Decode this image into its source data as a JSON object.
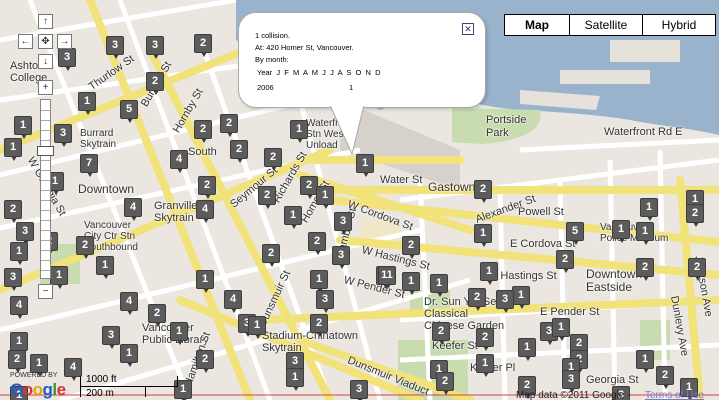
{
  "map_type": {
    "map": "Map",
    "satellite": "Satellite",
    "hybrid": "Hybrid"
  },
  "controls": {
    "up": "↑",
    "left": "←",
    "center": "✥",
    "right": "→",
    "down": "↓",
    "zoom_in": "+",
    "zoom_out": "−"
  },
  "info": {
    "line1": "1 collision.",
    "line2": "At: 420 Homer St, Vancouver.",
    "line3": "By month:",
    "header": "Year  J  F  M  A  M  J  J  A  S  O  N  D",
    "row_year": "2006",
    "row_value": "1",
    "close": "✕"
  },
  "scale": {
    "ft": "1000 ft",
    "m": "200 m"
  },
  "attribution": {
    "powered": "POWERED BY",
    "logo": "Google",
    "copyright": "Map data ©2011 Google -",
    "terms": "Terms of Use"
  },
  "labels": {
    "burrard": "Burrard St",
    "hornby": "Hornby St",
    "w_georgia": "W Georgia St",
    "seymour": "Seymour St",
    "richards": "Richards St",
    "homer": "Homer St",
    "cambie": "Cambie St",
    "water": "Water St",
    "gastown": "Gastown",
    "w_cordova": "W Cordova St",
    "powell": "Powell St",
    "e_cordova": "E Cordova St",
    "w_hastings": "W Hastings St",
    "e_hastings": "E Hastings St",
    "w_pender": "W Pender St",
    "e_pender": "E Pender St",
    "dunsmuir": "Dunsmuir St",
    "dunsmuir_viaduct": "Dunsmuir Viaduct",
    "keefer": "Keefer St",
    "keefer_pl": "Keefer Pl",
    "georgia": "Georgia St",
    "waterfront_rd": "Waterfront Rd E",
    "alexander": "Alexander St",
    "downtown": "Downtown",
    "downtown_eastside": "Downtown\nEastside",
    "portside": "Portside\nPark",
    "granville": "Granville\nSkytrain",
    "waterfront_stn": "Waterfront\nStn West\nUnload",
    "burrard_sky": "Burrard\nSkytrain",
    "vcc": "Vancouver\nCity Ctr Stn\nSouthbound",
    "stadium": "Stadium-Chinatown\nSkytrain",
    "public_lib": "Vancouver\nPublic Library",
    "dr_sun": "Dr. Sun Yat-Sen\nClassical\nChinese Garden",
    "museum": "Vancouver\nPolice Museum",
    "hamilton": "Hamilton St",
    "dunlevy": "Dunlevy Ave",
    "jackson": "Jackson Ave",
    "thurlow": "Thurlow St",
    "ashton": "Ashto\nCollege",
    "south": "South"
  },
  "markers": [
    "3",
    "3",
    "2",
    "3",
    "1",
    "2",
    "1",
    "5",
    "2",
    "2",
    "1",
    "2",
    "2",
    "1",
    "3",
    "7",
    "4",
    "2",
    "2",
    "2",
    "1",
    "1",
    "2",
    "1",
    "4",
    "4",
    "1",
    "2",
    "3",
    "2",
    "2",
    "3",
    "1",
    "2",
    "2",
    "2",
    "1",
    "3",
    "1",
    "3",
    "1",
    "4",
    "1",
    "4",
    "2",
    "3",
    "1",
    "4",
    "1",
    "2",
    "5",
    "2",
    "11",
    "1",
    "1",
    "1",
    "2",
    "1",
    "3",
    "2",
    "1",
    "4",
    "1",
    "2",
    "3",
    "2",
    "3",
    "1",
    "2",
    "2",
    "2",
    "3",
    "1",
    "1",
    "2",
    "2",
    "1",
    "1",
    "2",
    "1",
    "1",
    "2",
    "1",
    "1",
    "1",
    "2",
    "1",
    "1",
    "2",
    "3",
    "2",
    "3",
    "1",
    "1",
    "1",
    "1",
    "3",
    "3"
  ]
}
